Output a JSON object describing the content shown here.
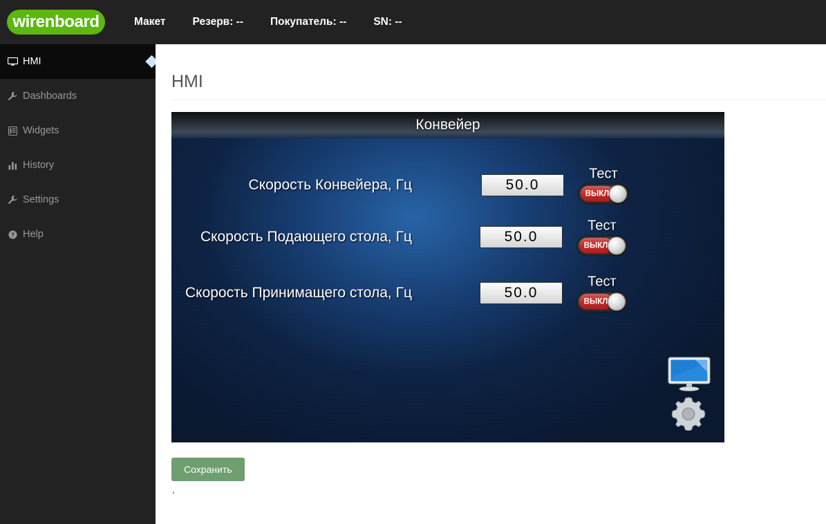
{
  "brand": {
    "logo_text": "wirenboard",
    "logo_color": "#5cb811"
  },
  "topnav": {
    "items": [
      {
        "label": "Макет"
      },
      {
        "label": "Резерв: --"
      },
      {
        "label": "Покупатель: --"
      },
      {
        "label": "SN: --"
      }
    ]
  },
  "sidebar": {
    "items": [
      {
        "label": "HMI",
        "icon": "monitor-icon",
        "active": true
      },
      {
        "label": "Dashboards",
        "icon": "wrench-icon",
        "active": false
      },
      {
        "label": "Widgets",
        "icon": "list-icon",
        "active": false
      },
      {
        "label": "History",
        "icon": "bar-chart-icon",
        "active": false
      },
      {
        "label": "Settings",
        "icon": "wrench-icon",
        "active": false
      },
      {
        "label": "Help",
        "icon": "question-circle-icon",
        "active": false
      }
    ]
  },
  "main": {
    "page_title": "HMI",
    "hmi_panel": {
      "title": "Конвейер",
      "rows": [
        {
          "label": "Скорость Конвейера, Гц",
          "value": "50.0",
          "toggle_caption": "Тест",
          "toggle_state": "ВЫКЛ"
        },
        {
          "label": "Скорость Подающего стола, Гц",
          "value": "50.0",
          "toggle_caption": "Тест",
          "toggle_state": "ВЫКЛ"
        },
        {
          "label": "Скорость Принимащего стола, Гц",
          "value": "50.0",
          "toggle_caption": "Тест",
          "toggle_state": "ВЫКЛ"
        }
      ],
      "corner_icons": [
        {
          "name": "monitor-icon"
        },
        {
          "name": "gear-icon"
        }
      ]
    },
    "save_label": "Сохранить",
    "trailing_text": ","
  },
  "colors": {
    "brand_green": "#5cb811",
    "save_green": "#6f9e6f",
    "toggle_off_red": "#c02a2a",
    "panel_blue": "#1b4f94",
    "chrome_dark": "#222222"
  }
}
